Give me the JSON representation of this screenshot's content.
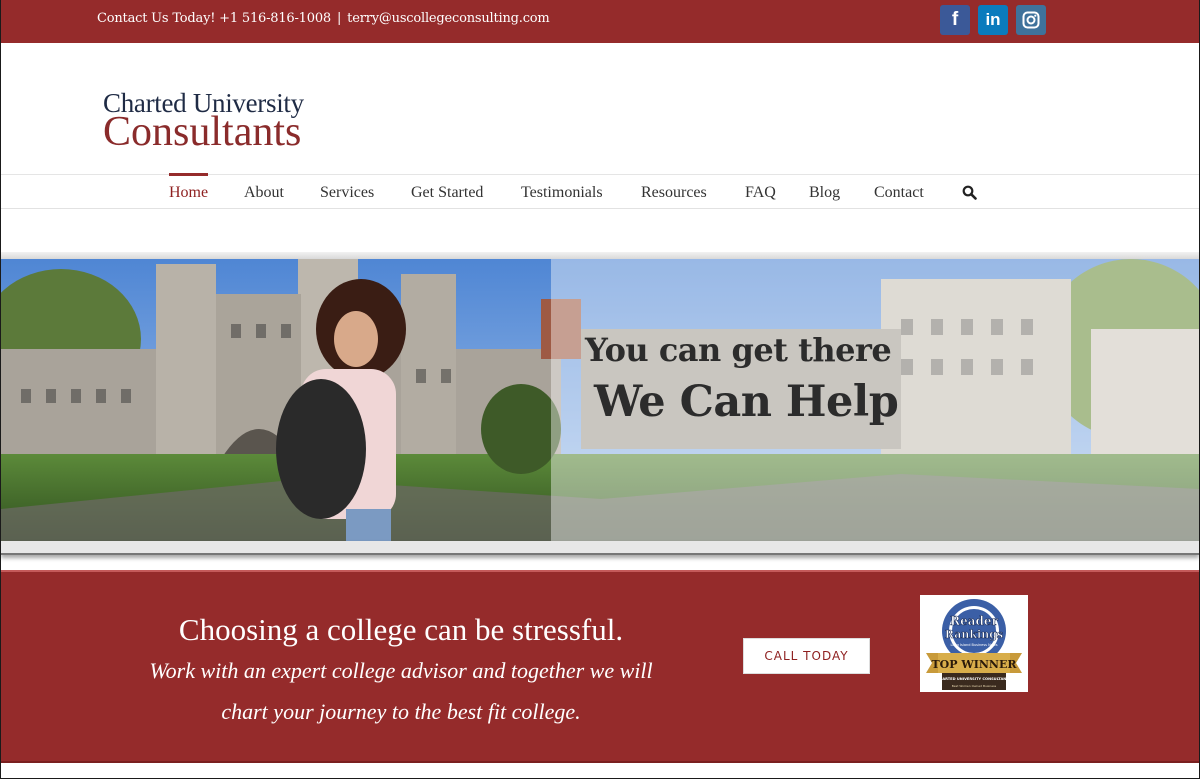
{
  "topbar": {
    "contact_label": "Contact Us Today! +1 516-816-1008",
    "separator": "|",
    "email": "terry@uscollegeconsulting.com",
    "social": [
      {
        "name": "facebook",
        "glyph": "f",
        "color": "#3b5998"
      },
      {
        "name": "linkedin",
        "glyph": "in",
        "color": "#0a7bbd"
      },
      {
        "name": "instagram",
        "glyph": "instagram-icon",
        "color": "#3f729b"
      }
    ]
  },
  "logo": {
    "line1": "Charted University",
    "line2": "Consultants"
  },
  "nav": {
    "items": [
      {
        "label": "Home",
        "active": true
      },
      {
        "label": "About"
      },
      {
        "label": "Services"
      },
      {
        "label": "Get Started"
      },
      {
        "label": "Testimonials"
      },
      {
        "label": "Resources"
      },
      {
        "label": "FAQ"
      },
      {
        "label": "Blog"
      },
      {
        "label": "Contact"
      }
    ],
    "search_icon": "search-icon"
  },
  "hero": {
    "line1": "You can get there",
    "line2": "We Can Help"
  },
  "banner": {
    "heading": "Choosing a college can be stressful.",
    "line1": "Work with an expert college advisor and together we will",
    "line2": "chart your journey to the best fit college.",
    "cta_label": "CALL TODAY",
    "badge": {
      "title1": "Reader",
      "title2": "Rankings",
      "subtitle": "Long Island Business News",
      "ribbon": "TOP WINNER",
      "company": "CHARTED UNIVERSITY CONSULTANTS",
      "category": "Best Women Owned Business"
    }
  },
  "colors": {
    "brand": "#952b2b",
    "navy": "#1f2b45"
  }
}
